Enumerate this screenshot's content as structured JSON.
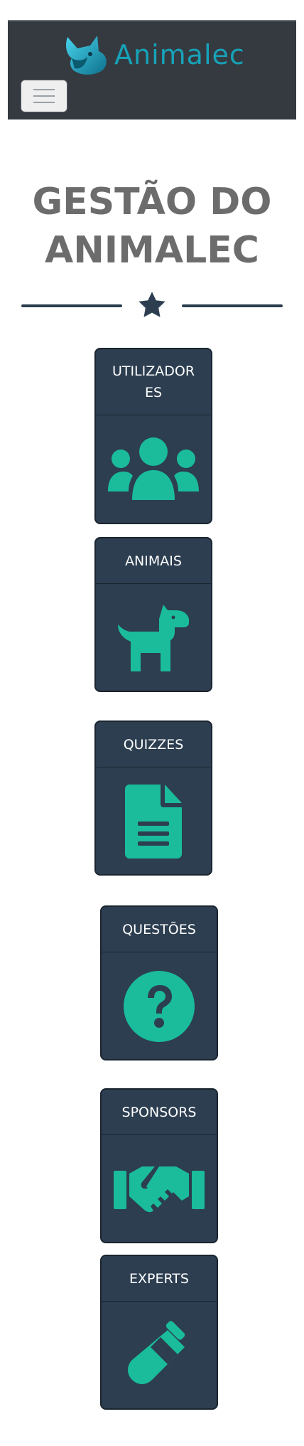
{
  "navbar": {
    "brand_name": "Animalec",
    "logo_icon": "fox-logo-icon",
    "toggler_icon": "hamburger-menu-icon"
  },
  "page": {
    "title_line1": "GESTÃO DO",
    "title_line2": "ANIMALEC",
    "divider_icon": "star-icon"
  },
  "cards": [
    {
      "label_line1": "UTILIZADOR",
      "label_line2": "ES",
      "icon": "users-icon"
    },
    {
      "label": "ANIMAIS",
      "icon": "dog-icon"
    },
    {
      "label": "QUIZZES",
      "icon": "document-icon"
    },
    {
      "label": "QUESTÕES",
      "icon": "question-circle-icon"
    },
    {
      "label": "SPONSORS",
      "icon": "handshake-icon"
    },
    {
      "label": "EXPERTS",
      "icon": "test-tube-icon"
    }
  ],
  "colors": {
    "navbar_bg": "#343a40",
    "brand": "#17a2b8",
    "card_bg": "#2c3e50",
    "icon_accent": "#1abc9c",
    "title": "#6c6c6c"
  }
}
